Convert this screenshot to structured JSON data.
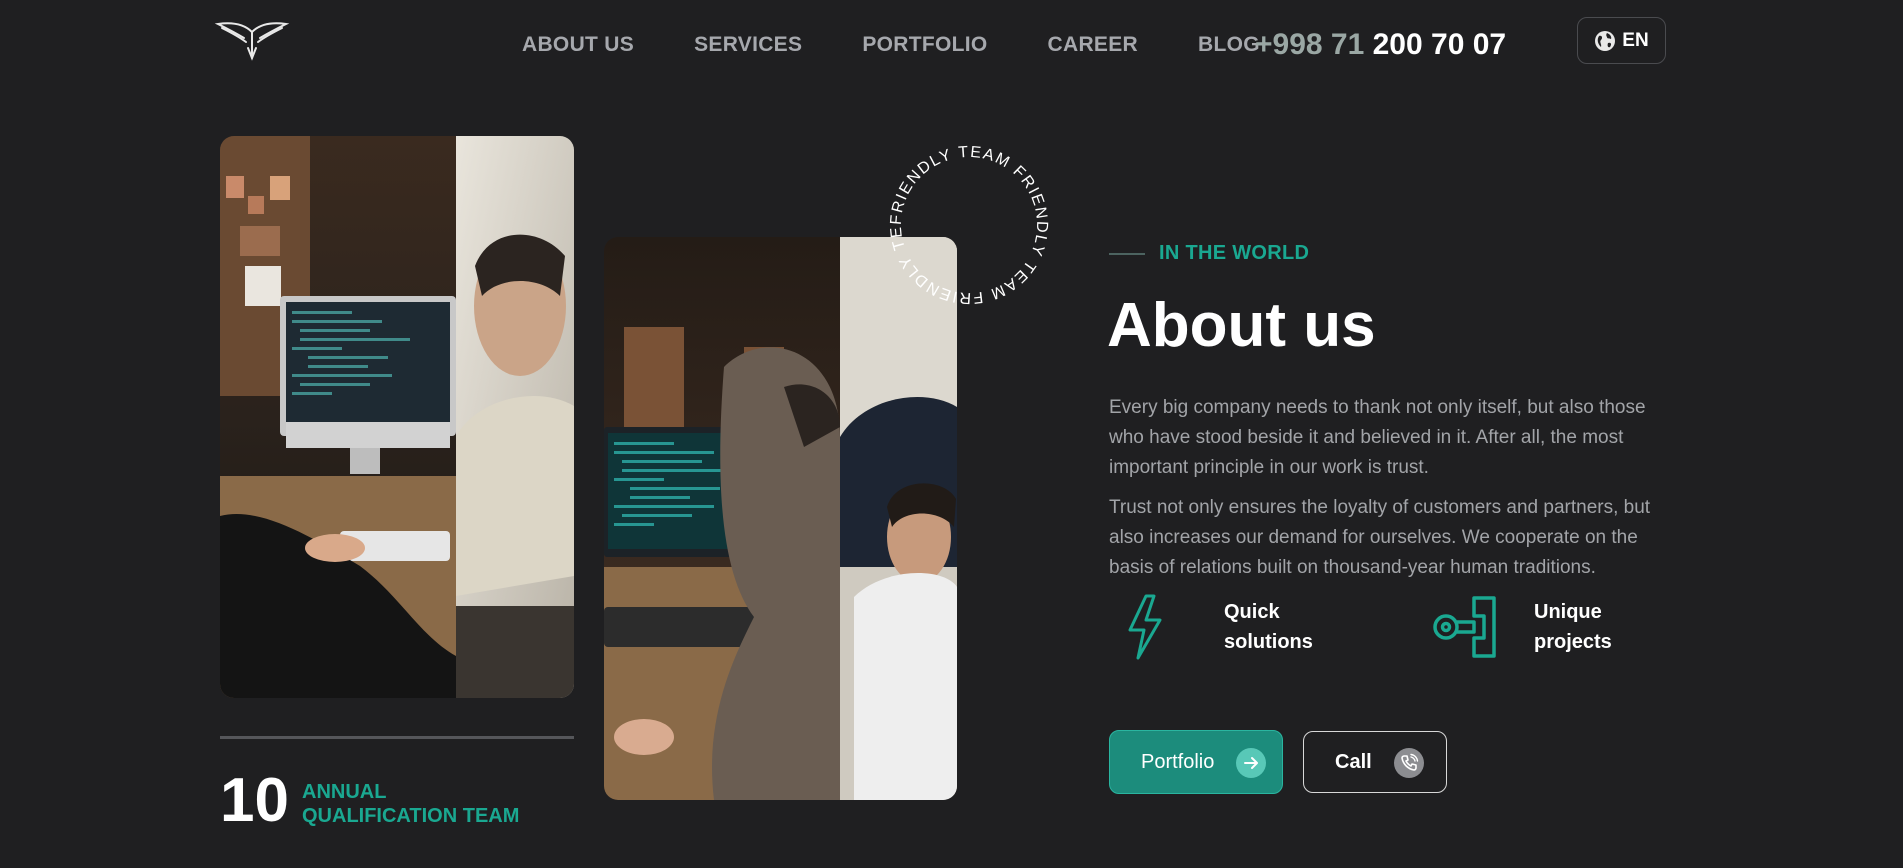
{
  "header": {
    "logo_icon": "winged-logo-icon",
    "nav": [
      {
        "label": "ABOUT US"
      },
      {
        "label": "SERVICES"
      },
      {
        "label": "PORTFOLIO"
      },
      {
        "label": "CAREER"
      },
      {
        "label": "BLOG"
      }
    ],
    "phone_code": "+998 71",
    "phone_number": "200 70 07",
    "language": "EN"
  },
  "badge": {
    "text": "FRIENDLY TEAM FRIENDLY TEAM FRIENDLY TEAM"
  },
  "stat": {
    "number": "10",
    "label": "ANNUAL QUALIFICATION TEAM"
  },
  "about": {
    "eyebrow": "IN THE WORLD",
    "title": "About us",
    "paragraph1": "Every big company needs to thank not only itself, but also those who have stood beside it and believed in it. After all, the most important principle in our work is trust.",
    "paragraph2": "Trust not only ensures the loyalty of customers and partners, but also increases our demand for ourselves. We cooperate on the basis of relations built on thousand-year human traditions.",
    "features": [
      {
        "label": "Quick solutions",
        "icon": "lightning-icon"
      },
      {
        "label": "Unique projects",
        "icon": "key-icon"
      }
    ],
    "buttons": {
      "portfolio": "Portfolio",
      "call": "Call"
    }
  },
  "colors": {
    "background": "#1f1f21",
    "accent": "#1aa891",
    "button": "#1c8c7c"
  }
}
